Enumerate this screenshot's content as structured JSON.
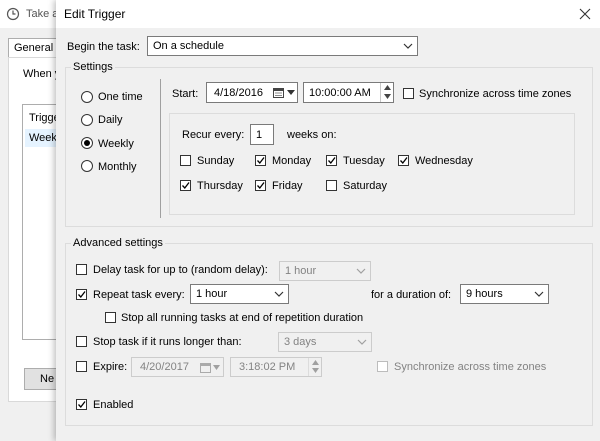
{
  "background_window": {
    "title": "Take a",
    "tab_general": "General",
    "when_label": "When y",
    "list_col": "Trigge",
    "list_row": "Week",
    "new_button": "Ne"
  },
  "dialog": {
    "title": "Edit Trigger",
    "begin_label": "Begin the task:",
    "begin_value": "On a schedule",
    "settings": {
      "label": "Settings",
      "frequency_options": [
        {
          "label": "One time",
          "selected": false
        },
        {
          "label": "Daily",
          "selected": false
        },
        {
          "label": "Weekly",
          "selected": true
        },
        {
          "label": "Monthly",
          "selected": false
        }
      ],
      "start_label": "Start:",
      "start_date": "4/18/2016",
      "start_time": "10:00:00 AM",
      "sync_label": "Synchronize across time zones",
      "sync_checked": false,
      "recur_label": "Recur every:",
      "recur_value": "1",
      "weeks_on_label": "weeks on:",
      "days": [
        {
          "label": "Sunday",
          "checked": false
        },
        {
          "label": "Monday",
          "checked": true
        },
        {
          "label": "Tuesday",
          "checked": true
        },
        {
          "label": "Wednesday",
          "checked": true
        },
        {
          "label": "Thursday",
          "checked": true
        },
        {
          "label": "Friday",
          "checked": true
        },
        {
          "label": "Saturday",
          "checked": false
        }
      ]
    },
    "advanced": {
      "label": "Advanced settings",
      "delay_label": "Delay task for up to (random delay):",
      "delay_checked": false,
      "delay_value": "1 hour",
      "repeat_label": "Repeat task every:",
      "repeat_checked": true,
      "repeat_value": "1 hour",
      "duration_label": "for a duration of:",
      "duration_value": "9 hours",
      "stop_all_label": "Stop all running tasks at end of repetition duration",
      "stop_all_checked": false,
      "stop_long_label": "Stop task if it runs longer than:",
      "stop_long_checked": false,
      "stop_long_value": "3 days",
      "expire_label": "Expire:",
      "expire_checked": false,
      "expire_date": "4/20/2017",
      "expire_time": "3:18:02 PM",
      "expire_sync_label": "Synchronize across time zones",
      "expire_sync_checked": false,
      "enabled_label": "Enabled",
      "enabled_checked": true
    }
  }
}
